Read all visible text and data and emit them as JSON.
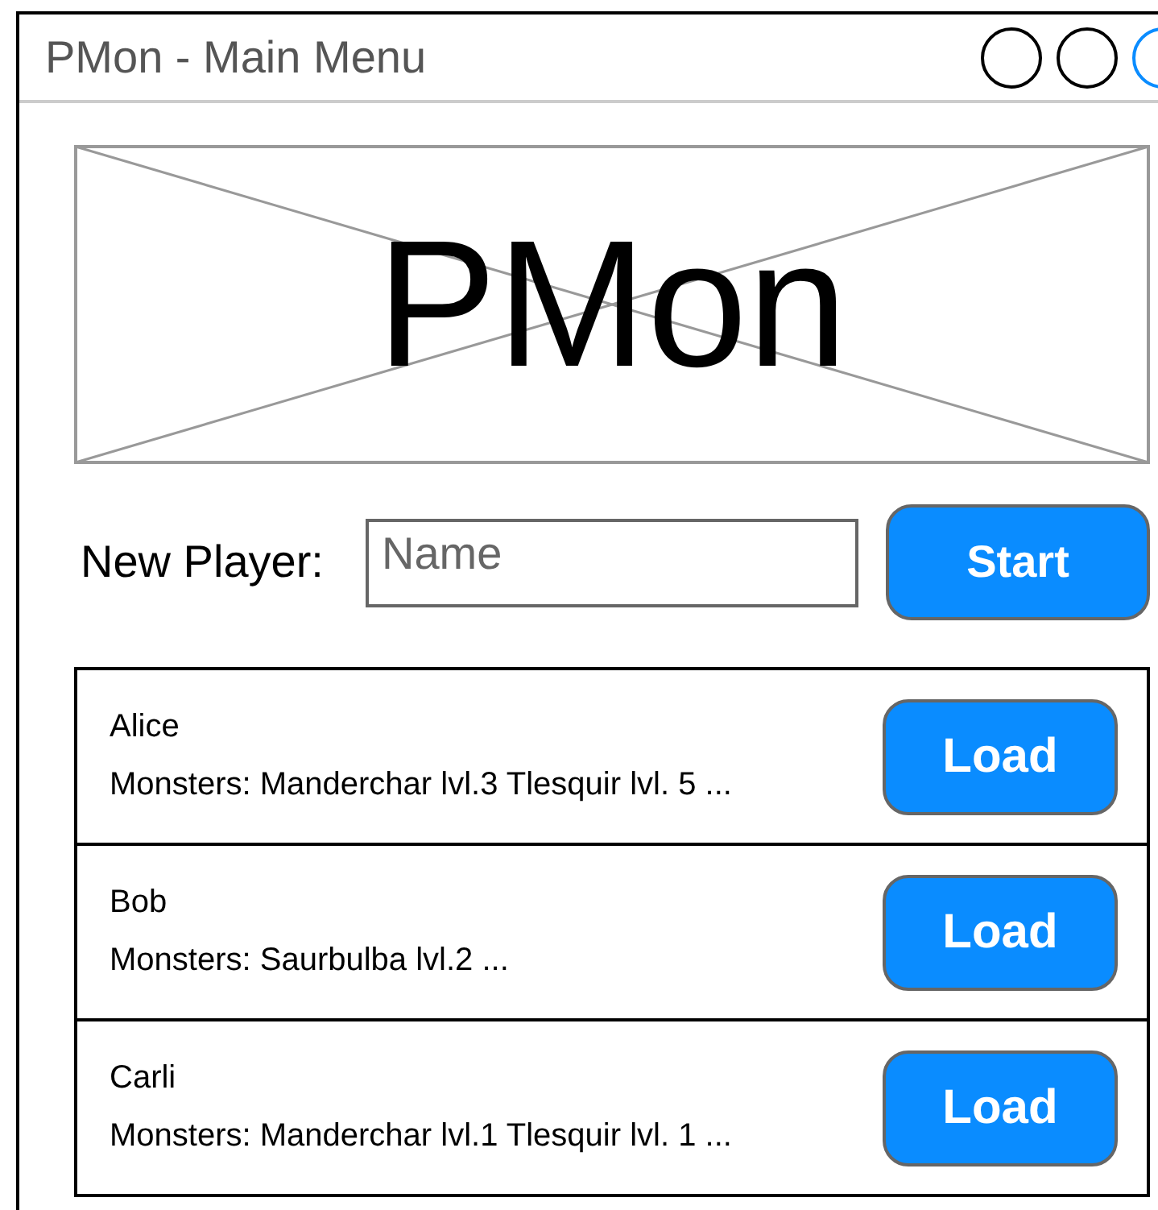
{
  "window": {
    "title": "PMon - Main Menu",
    "controls": [
      {
        "selected": false
      },
      {
        "selected": false
      },
      {
        "selected": true
      }
    ]
  },
  "banner": {
    "text": "PMon"
  },
  "new_player": {
    "label": "New Player:",
    "placeholder": "Name",
    "button": "Start"
  },
  "players": [
    {
      "name": "Alice",
      "monsters": "Monsters: Manderchar lvl.3 Tlesquir lvl. 5 ...",
      "button": "Load"
    },
    {
      "name": "Bob",
      "monsters": "Monsters: Saurbulba lvl.2 ...",
      "button": "Load"
    },
    {
      "name": "Carli",
      "monsters": "Monsters: Manderchar lvl.1 Tlesquir lvl. 1 ...",
      "button": "Load"
    }
  ]
}
